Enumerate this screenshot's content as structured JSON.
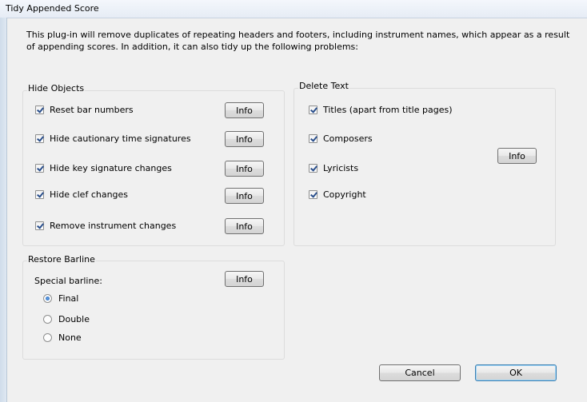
{
  "window": {
    "title": "Tidy Appended Score"
  },
  "intro": "This plug-in will remove duplicates of repeating headers and footers, including instrument names, which appear as a result of appending scores. In addition, it can also tidy up the following problems:",
  "hide_objects": {
    "legend": "Hide Objects",
    "items": [
      {
        "label": "Reset bar numbers",
        "checked": true,
        "info": "Info"
      },
      {
        "label": "Hide cautionary time signatures",
        "checked": true,
        "info": "Info"
      },
      {
        "label": "Hide key signature changes",
        "checked": true,
        "info": "Info"
      },
      {
        "label": "Hide clef changes",
        "checked": true,
        "info": "Info"
      },
      {
        "label": "Remove instrument changes",
        "checked": true,
        "info": "Info"
      }
    ]
  },
  "delete_text": {
    "legend": "Delete Text",
    "items": [
      {
        "label": "Titles (apart from title pages)",
        "checked": true
      },
      {
        "label": "Composers",
        "checked": true
      },
      {
        "label": "Lyricists",
        "checked": true
      },
      {
        "label": "Copyright",
        "checked": true
      }
    ],
    "info": "Info"
  },
  "restore_barline": {
    "legend": "Restore Barline",
    "label": "Special barline:",
    "info": "Info",
    "options": [
      {
        "label": "Final",
        "selected": true
      },
      {
        "label": "Double",
        "selected": false
      },
      {
        "label": "None",
        "selected": false
      }
    ]
  },
  "buttons": {
    "cancel": "Cancel",
    "ok": "OK"
  }
}
